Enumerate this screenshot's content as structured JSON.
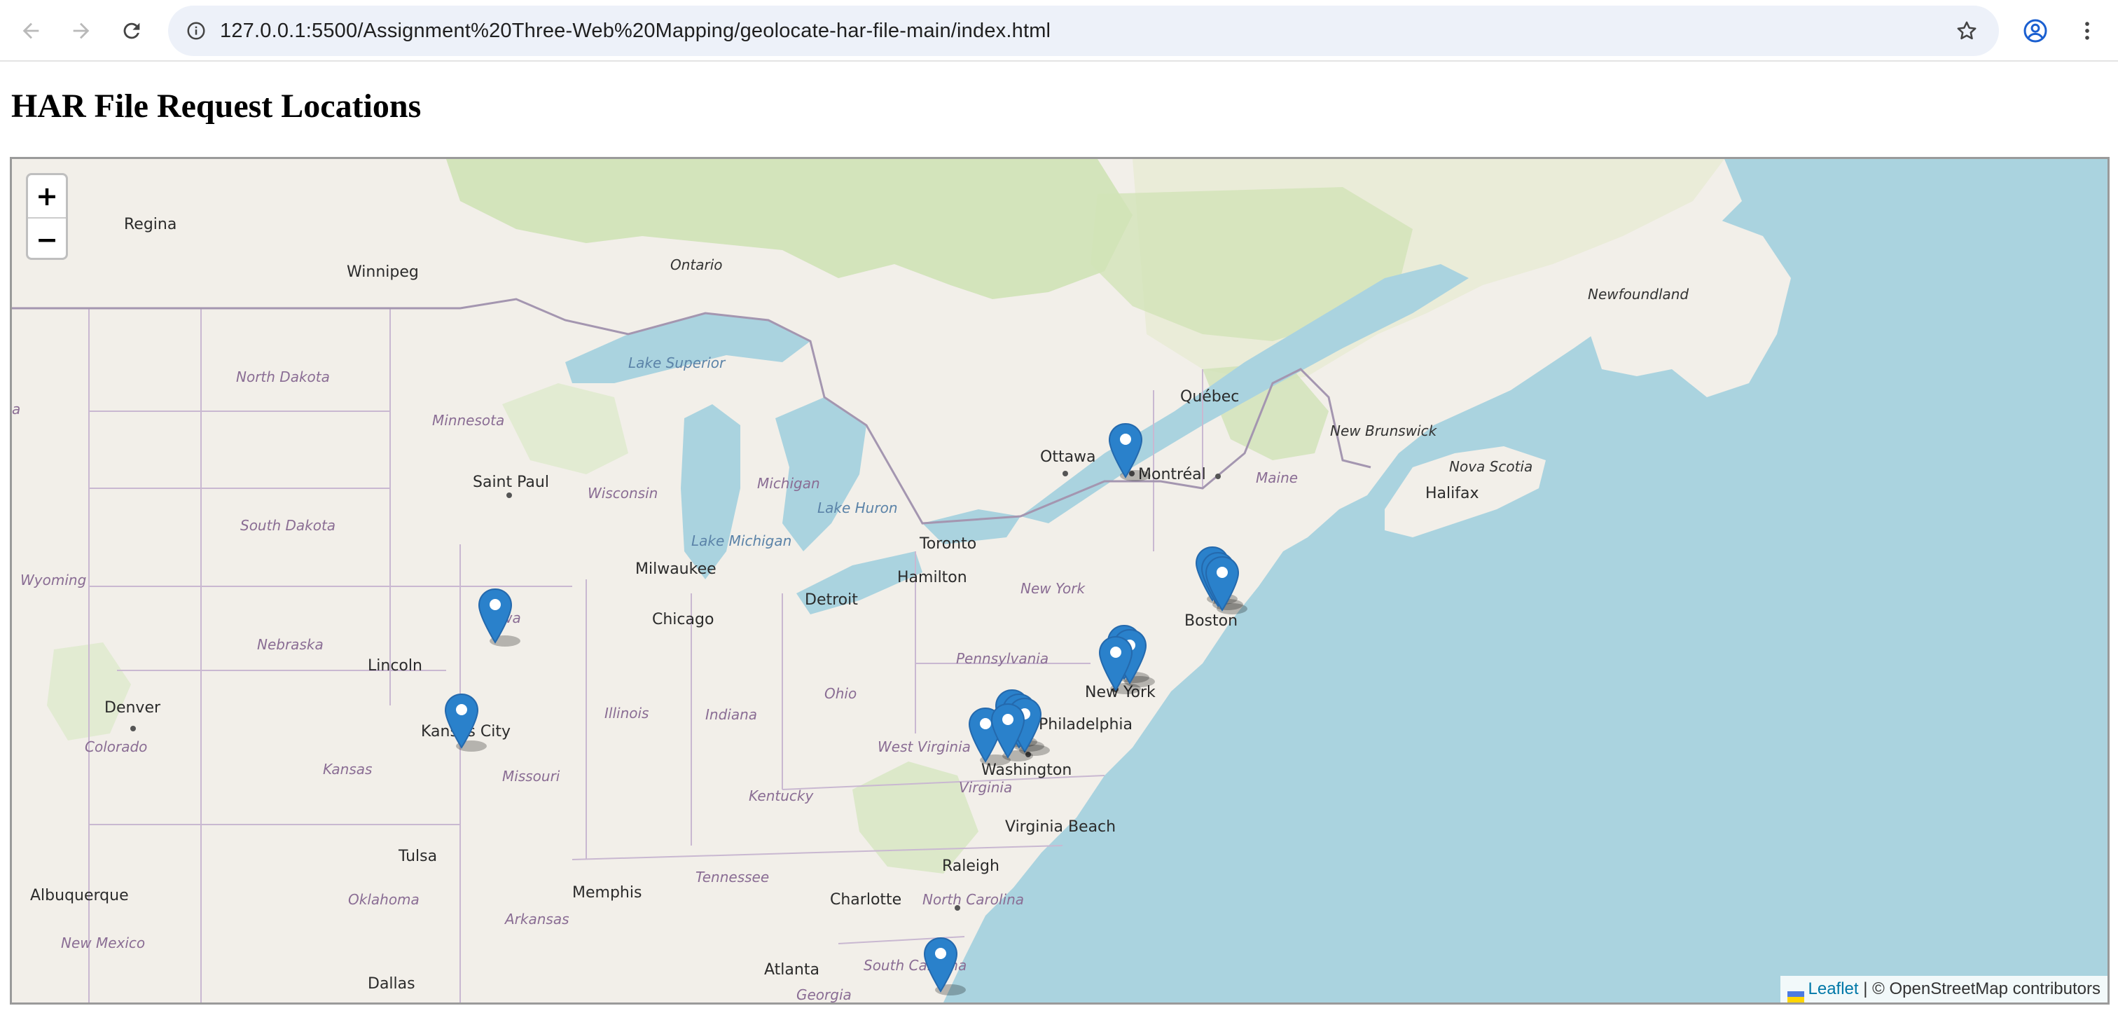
{
  "browser": {
    "url": "127.0.0.1:5500/Assignment%20Three-Web%20Mapping/geolocate-har-file-main/index.html",
    "icons": {
      "back": "arrow-left-icon",
      "forward": "arrow-right-icon",
      "reload": "reload-icon",
      "site_info": "info-circle-icon",
      "bookmark": "star-icon",
      "profile": "account-circle-icon",
      "menu": "kebab-menu-icon"
    }
  },
  "page": {
    "title": "HAR File Request Locations"
  },
  "map": {
    "zoom_in_label": "+",
    "zoom_out_label": "−",
    "attribution": {
      "link": "Leaflet",
      "separator": "|",
      "text": "© OpenStreetMap contributors"
    },
    "colors": {
      "water": "#aad3df",
      "land": "#f2efe9",
      "forest": "#c8dfb0",
      "marker": "#2a81cb",
      "border": "#b4a0c2"
    },
    "labels": {
      "regina": "Regina",
      "winnipeg": "Winnipeg",
      "ontario": "Ontario",
      "newfoundland": "Newfoundland",
      "north_dakota": "North Dakota",
      "lake_superior": "Lake Superior",
      "minnesota": "Minnesota",
      "quebec": "Québec",
      "new_brunswick": "New Brunswick",
      "ottawa": "Ottawa",
      "montreal": "Montréal",
      "maine": "Maine",
      "nova_scotia": "Nova Scotia",
      "saint_paul": "Saint Paul",
      "michigan": "Michigan",
      "wisconsin": "Wisconsin",
      "lake_huron": "Lake Huron",
      "halifax": "Halifax",
      "south_dakota": "South Dakota",
      "toronto": "Toronto",
      "lake_michigan": "Lake Michigan",
      "wyoming": "Wyoming",
      "milwaukee": "Milwaukee",
      "hamilton": "Hamilton",
      "new_york_state": "New York",
      "detroit": "Detroit",
      "boston": "Boston",
      "iowa": "Iowa",
      "chicago": "Chicago",
      "nebraska": "Nebraska",
      "pennsylvania": "Pennsylvania",
      "lincoln": "Lincoln",
      "new_york": "New York",
      "ohio": "Ohio",
      "denver": "Denver",
      "illinois": "Illinois",
      "indiana": "Indiana",
      "philadelphia": "Philadelphia",
      "kansas_city": "Kansas City",
      "colorado": "Colorado",
      "west_virginia": "West Virginia",
      "washington": "Washington",
      "kansas": "Kansas",
      "missouri": "Missouri",
      "virginia": "Virginia",
      "kentucky": "Kentucky",
      "virginia_beach": "Virginia Beach",
      "tulsa": "Tulsa",
      "raleigh": "Raleigh",
      "tennessee": "Tennessee",
      "albuquerque": "Albuquerque",
      "memphis": "Memphis",
      "charlotte": "Charlotte",
      "oklahoma": "Oklahoma",
      "north_carolina": "North Carolina",
      "arkansas": "Arkansas",
      "new_mexico": "New Mexico",
      "atlanta": "Atlanta",
      "south_carolina": "South Carolina",
      "dallas": "Dallas",
      "georgia": "Georgia",
      "edge_a": "a"
    },
    "marker_icon": "map-pin-icon",
    "markers_count": 18
  }
}
